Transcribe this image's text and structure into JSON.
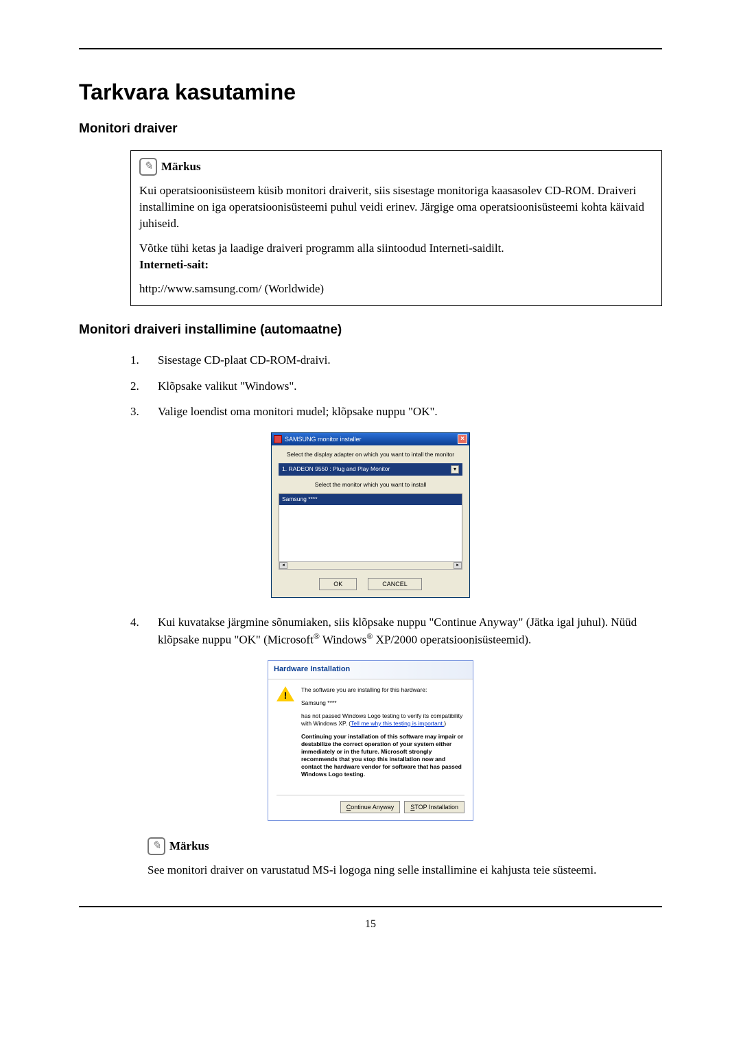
{
  "main_heading": "Tarkvara kasutamine",
  "section1": {
    "heading": "Monitori draiver",
    "note": {
      "label": "Märkus",
      "para1": "Kui operatsioonisüsteem küsib monitori draiverit, siis sisestage monitoriga kaasasolev CD-ROM. Draiveri installimine on iga operatsioonisüsteemi puhul veidi erinev. Järgige oma operatsioonisüsteemi kohta käivaid juhiseid.",
      "para2": "Võtke tühi ketas ja laadige draiveri programm alla siintoodud Interneti-saidilt.",
      "internet_label": "Interneti-sait:",
      "url": "http://www.samsung.com/ (Worldwide)"
    }
  },
  "section2": {
    "heading": "Monitori draiveri installimine (automaatne)",
    "steps": {
      "s1": "Sisestage CD-plaat CD-ROM-draivi.",
      "s2": "Klõpsake valikut \"Windows\".",
      "s3": "Valige loendist oma monitori mudel; klõpsake nuppu \"OK\".",
      "s4_pre": "Kui kuvatakse järgmine sõnumiaken, siis klõpsake nuppu \"Continue Anyway\" (Jätka igal juhul). Nüüd klõpsake nuppu \"OK\" (Microsoft",
      "s4_mid": " Windows",
      "s4_post": " XP/2000 operatsioonisüsteemid)."
    },
    "installer": {
      "title": "SAMSUNG monitor installer",
      "label1": "Select the display adapter on which you want to intall the monitor",
      "dropdown": "1. RADEON 9550 : Plug and Play Monitor",
      "label2": "Select the monitor which you want to install",
      "item": "Samsung ****",
      "btn_ok": "OK",
      "btn_cancel": "CANCEL"
    },
    "hw": {
      "title": "Hardware Installation",
      "line1": "The software you are installing for this hardware:",
      "line2": "Samsung ****",
      "line3a": "has not passed Windows Logo testing to verify its compatibility with Windows XP. (",
      "link": "Tell me why this testing is important.",
      "line3b": ")",
      "warn": "Continuing your installation of this software may impair or destabilize the correct operation of your system either immediately or in the future. Microsoft strongly recommends that you stop this installation now and contact the hardware vendor for software that has passed Windows Logo testing.",
      "btn_continue_u": "C",
      "btn_continue": "ontinue Anyway",
      "btn_stop_u": "S",
      "btn_stop": "TOP Installation"
    },
    "note2": {
      "label": "Märkus",
      "text": "See monitori draiver on varustatud MS-i logoga ning selle installimine ei kahjusta teie süsteemi."
    }
  },
  "page_number": "15"
}
